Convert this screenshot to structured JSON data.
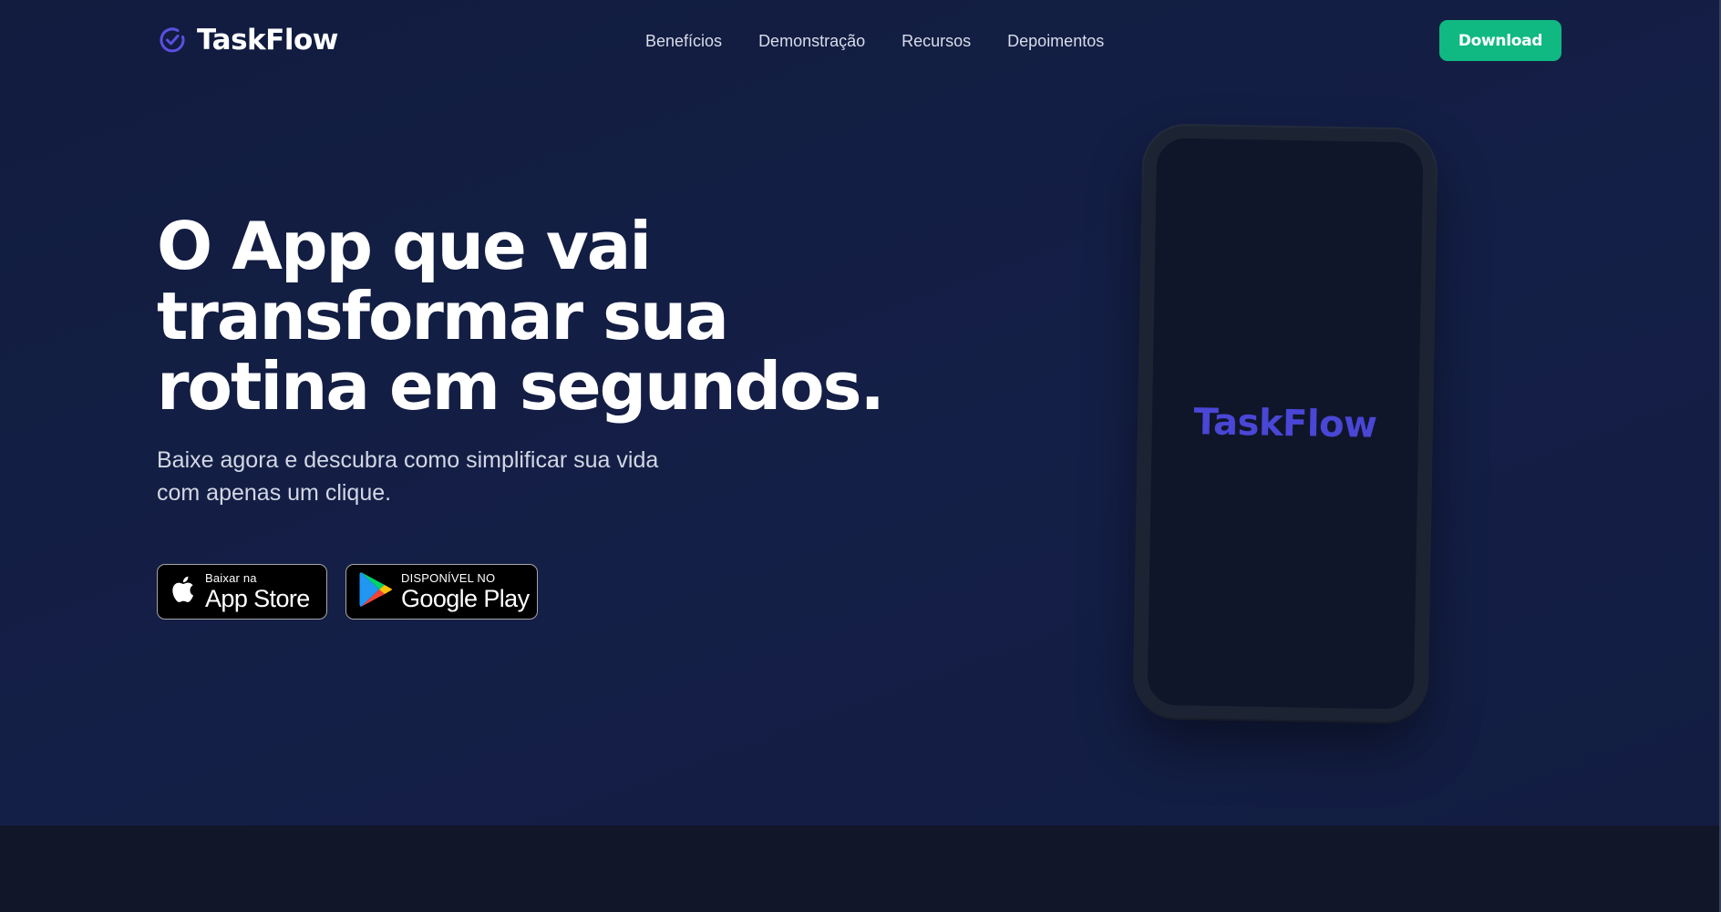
{
  "brand": {
    "name": "TaskFlow",
    "logo_icon": "check-circle-icon",
    "accent_color": "#5b4fe0"
  },
  "nav": {
    "items": [
      {
        "label": "Benefícios"
      },
      {
        "label": "Demonstração"
      },
      {
        "label": "Recursos"
      },
      {
        "label": "Depoimentos"
      }
    ],
    "cta_label": "Download",
    "cta_color": "#10b981"
  },
  "hero": {
    "headline_lines": [
      "O App que vai",
      "transformar sua",
      "rotina em segundos."
    ],
    "subtitle_lines": [
      "Baixe agora e descubra como simplificar sua vida",
      "com apenas um clique."
    ]
  },
  "badges": {
    "apple": {
      "icon": "apple-icon",
      "small_label": "Baixar na",
      "big_label": "App Store"
    },
    "google": {
      "icon": "google-play-icon",
      "small_label": "DISPONÍVEL NO",
      "big_label": "Google Play"
    }
  },
  "phone_mockup": {
    "screen_text": "TaskFlow",
    "screen_text_color": "#4a46d6"
  },
  "colors": {
    "hero_background": "#131d42",
    "footer_band": "#111729"
  }
}
